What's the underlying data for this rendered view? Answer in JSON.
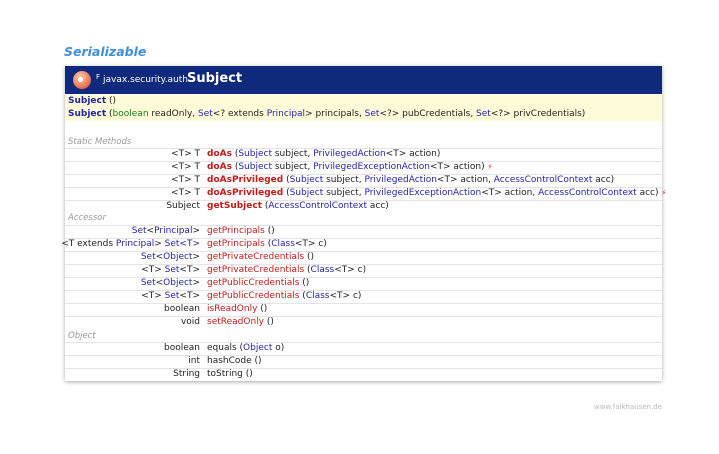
{
  "diagram": {
    "interface": "Serializable",
    "header": {
      "modifier": "F",
      "package": "javax.security.auth.",
      "class_name": "Subject"
    },
    "constructors": [
      {
        "name": "Subject",
        "params": " ()"
      },
      {
        "name": "Subject",
        "params_parts": [
          " (",
          "boolean",
          " readOnly, ",
          "Set",
          "<? extends ",
          "Principal",
          "> principals, ",
          "Set",
          "<?> pubCredentials, ",
          "Set",
          "<?> privCredentials)"
        ]
      }
    ],
    "sections": {
      "static": "Static Methods",
      "accessor": "Accessor",
      "object": "Object"
    },
    "static_methods": [
      {
        "ret": "<T> T",
        "name": "doAs",
        "p": [
          " (",
          "Subject",
          " subject, ",
          "PrivilegedAction",
          "<T> action)"
        ],
        "flag": ""
      },
      {
        "ret": "<T> T",
        "name": "doAs",
        "p": [
          " (",
          "Subject",
          " subject, ",
          "PrivilegedExceptionAction",
          "<T> action)"
        ],
        "flag": "⚡"
      },
      {
        "ret": "<T> T",
        "name": "doAsPrivileged",
        "p": [
          " (",
          "Subject",
          " subject, ",
          "PrivilegedAction",
          "<T> action, ",
          "AccessControlContext",
          " acc)"
        ],
        "flag": ""
      },
      {
        "ret": "<T> T",
        "name": "doAsPrivileged",
        "p": [
          " (",
          "Subject",
          " subject, ",
          "PrivilegedExceptionAction",
          "<T> action, ",
          "AccessControlContext",
          " acc)"
        ],
        "flag": "⚡"
      },
      {
        "ret": "Subject",
        "name": "getSubject",
        "p": [
          " (",
          "AccessControlContext",
          " acc)"
        ],
        "flag": ""
      }
    ],
    "accessors": [
      {
        "ret_a": "Set",
        "ret_b": "<",
        "ret_c": "Principal",
        "ret_d": ">",
        "name": "getPrincipals",
        "p": " ()"
      },
      {
        "ret_a": "<T extends ",
        "ret_b": "Principal",
        "ret_c": "> ",
        "ret_d": "Set<T>",
        "name": "getPrincipals",
        "p1": " (",
        "p2": "Class",
        "p3": "<T> c)"
      },
      {
        "ret_a": "Set",
        "ret_b": "<",
        "ret_c": "Object",
        "ret_d": ">",
        "name": "getPrivateCredentials",
        "p": " ()"
      },
      {
        "ret_a": "<T> ",
        "ret_b": "Set",
        "ret_c": "<T>",
        "ret_d": "",
        "name": "getPrivateCredentials",
        "p1": " (",
        "p2": "Class",
        "p3": "<T> c)"
      },
      {
        "ret_a": "Set",
        "ret_b": "<",
        "ret_c": "Object",
        "ret_d": ">",
        "name": "getPublicCredentials",
        "p": " ()"
      },
      {
        "ret_a": "<T> ",
        "ret_b": "Set",
        "ret_c": "<T>",
        "ret_d": "",
        "name": "getPublicCredentials",
        "p1": " (",
        "p2": "Class",
        "p3": "<T> c)"
      },
      {
        "ret": "boolean",
        "name": "isReadOnly",
        "p": " ()"
      },
      {
        "ret": "void",
        "name": "setReadOnly",
        "p": " ()"
      }
    ],
    "object_methods": [
      {
        "ret": "boolean",
        "name": "equals",
        "p1": " (",
        "p2": "Object",
        "p3": " o)"
      },
      {
        "ret": "int",
        "name": "hashCode",
        "p": " ()"
      },
      {
        "ret": "String",
        "name": "toString",
        "p": " ()"
      }
    ],
    "footer": "www.falkhausen.de"
  }
}
